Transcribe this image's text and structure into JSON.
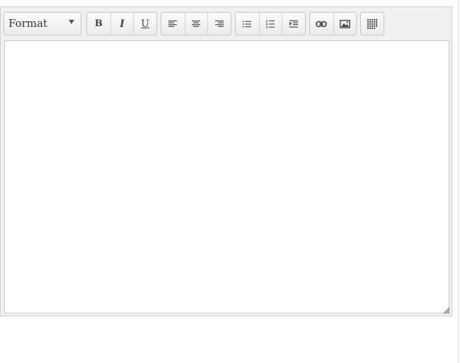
{
  "toolbar": {
    "format_select": {
      "label": "Format",
      "icon": "dropdown-arrow-icon"
    },
    "groups": [
      {
        "name": "text-style",
        "buttons": [
          {
            "id": "bold",
            "glyph": "B"
          },
          {
            "id": "italic",
            "glyph": "I"
          },
          {
            "id": "underline",
            "glyph": "U"
          }
        ]
      },
      {
        "name": "alignment",
        "buttons": [
          {
            "id": "align-left",
            "icon": "align-left-icon"
          },
          {
            "id": "align-center",
            "icon": "align-center-icon"
          },
          {
            "id": "align-right",
            "icon": "align-right-icon"
          }
        ]
      },
      {
        "name": "lists",
        "buttons": [
          {
            "id": "bullet-list",
            "icon": "bullet-list-icon"
          },
          {
            "id": "numbered-list",
            "icon": "numbered-list-icon"
          },
          {
            "id": "indent",
            "icon": "indent-icon"
          }
        ]
      },
      {
        "name": "insert",
        "buttons": [
          {
            "id": "link",
            "icon": "link-icon"
          },
          {
            "id": "image",
            "icon": "image-icon"
          }
        ]
      },
      {
        "name": "table",
        "buttons": [
          {
            "id": "table",
            "icon": "table-icon"
          }
        ]
      }
    ]
  },
  "editor": {
    "content": ""
  },
  "colors": {
    "toolbar_bg": "#f0f0f0",
    "button_border": "#c5c5c5",
    "icon": "#444444",
    "content_bg": "#ffffff"
  }
}
